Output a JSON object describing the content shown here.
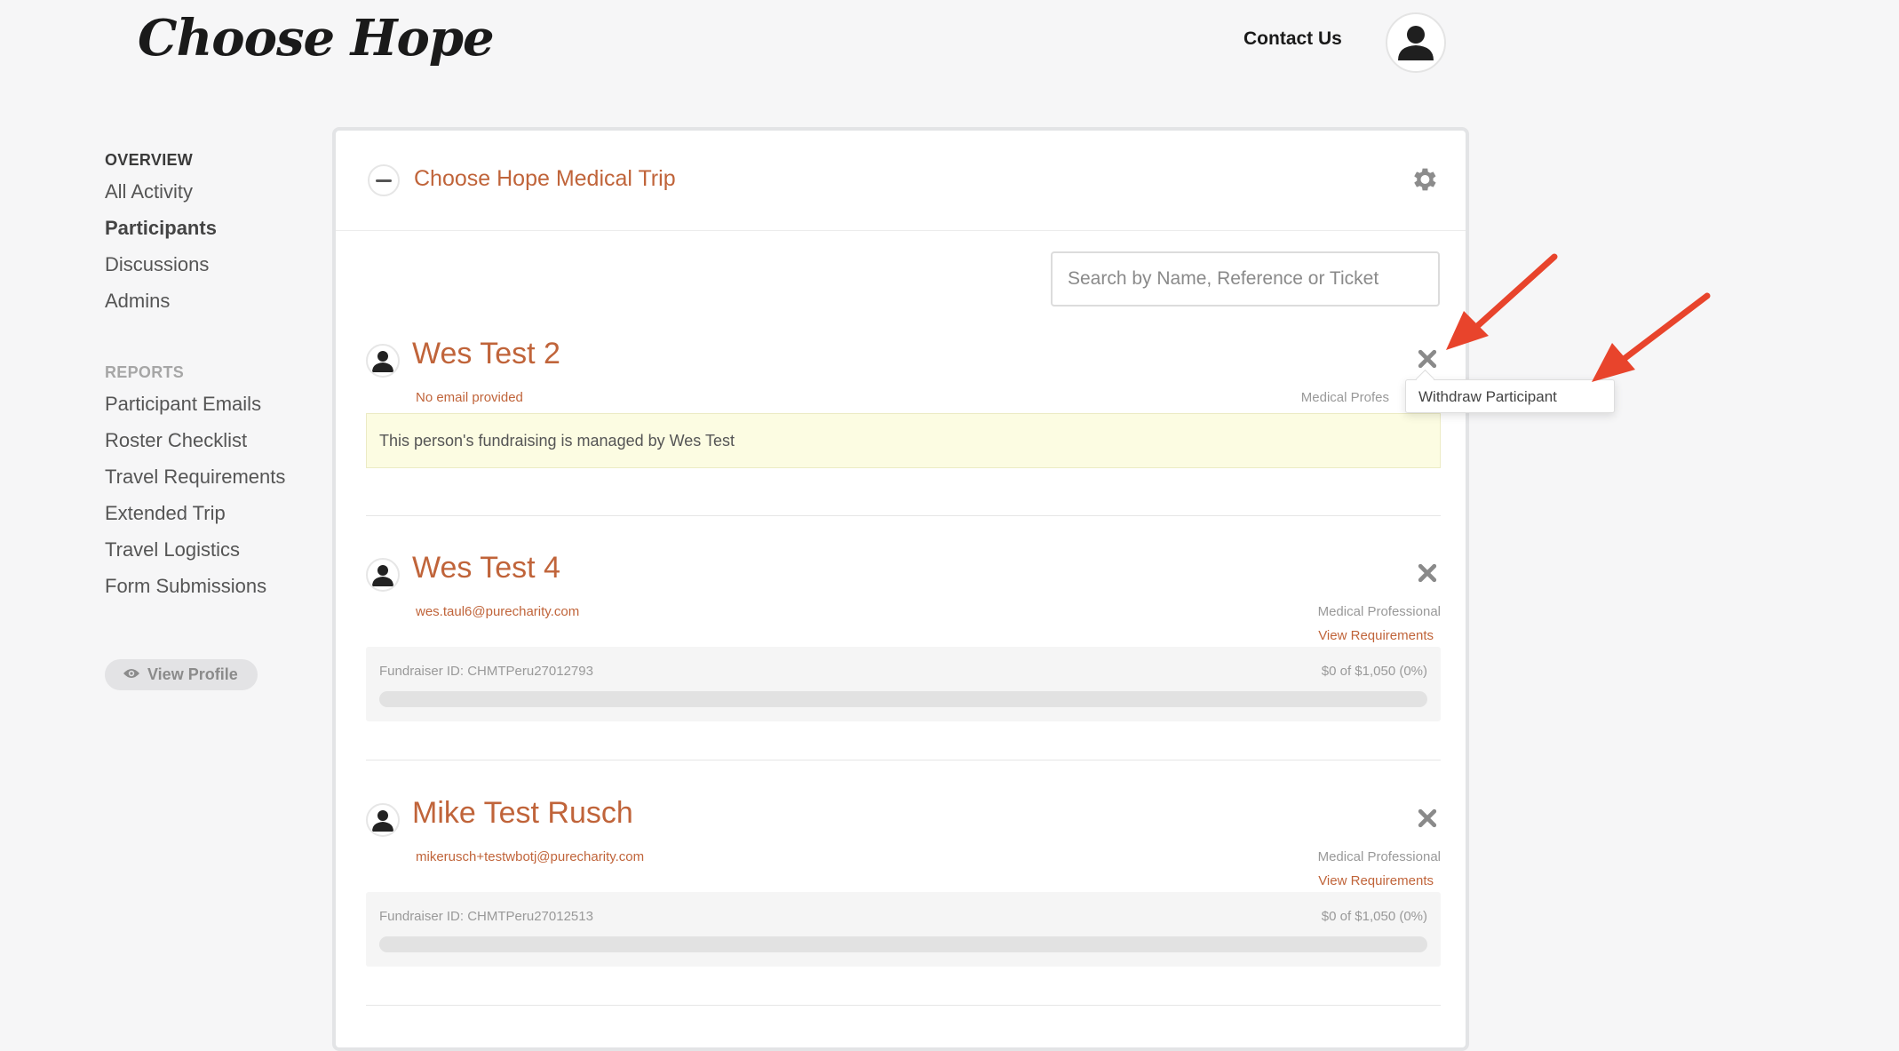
{
  "header": {
    "logo_text": "Choose Hope",
    "contact_label": "Contact Us",
    "avatar_icon": "user-icon"
  },
  "sidebar": {
    "overview_heading": "OVERVIEW",
    "overview_items": [
      {
        "label": "All Activity",
        "active": false
      },
      {
        "label": "Participants",
        "active": true
      },
      {
        "label": "Discussions",
        "active": false
      },
      {
        "label": "Admins",
        "active": false
      }
    ],
    "reports_heading": "REPORTS",
    "report_items": [
      {
        "label": "Participant Emails"
      },
      {
        "label": "Roster Checklist"
      },
      {
        "label": "Travel Requirements"
      },
      {
        "label": "Extended Trip"
      },
      {
        "label": "Travel Logistics"
      },
      {
        "label": "Form Submissions"
      }
    ],
    "view_profile_label": "View Profile"
  },
  "card": {
    "trip_title": "Choose Hope Medical Trip",
    "search_placeholder": "Search by Name, Reference or Ticket"
  },
  "participants": [
    {
      "name": "Wes Test 2",
      "email": "No email provided",
      "role": "Medical Profes",
      "notice": "This person's fundraising is managed by Wes Test"
    },
    {
      "name": "Wes Test 4",
      "email": "wes.taul6@purecharity.com",
      "role": "Medical Professional",
      "requirements_label": "View Requirements",
      "fundraiser_id": "Fundraiser ID: CHMTPeru27012793",
      "amount": "$0 of $1,050 (0%)",
      "progress": 0
    },
    {
      "name": "Mike Test Rusch",
      "email": "mikerusch+testwbotj@purecharity.com",
      "role": "Medical Professional",
      "requirements_label": "View Requirements",
      "fundraiser_id": "Fundraiser ID: CHMTPeru27012513",
      "amount": "$0 of $1,050 (0%)",
      "progress": 0
    }
  ],
  "tooltip": {
    "label": "Withdraw Participant"
  },
  "colors": {
    "accent": "#c0643a",
    "annotation_arrow": "#e8442c"
  }
}
